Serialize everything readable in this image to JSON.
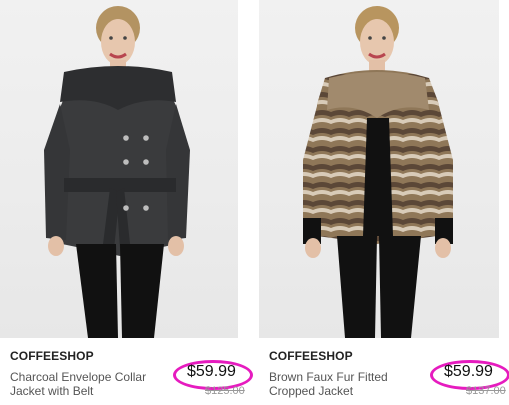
{
  "products": [
    {
      "brand": "COFFEESHOP",
      "name": "Charcoal Envelope Collar Jacket with Belt",
      "price": "$59.99",
      "original_price": "$125.00",
      "image_alt": "Woman wearing charcoal envelope collar jacket with belt"
    },
    {
      "brand": "COFFEESHOP",
      "name": "Brown Faux Fur Fitted Cropped Jacket",
      "price": "$59.99",
      "original_price": "$137.00",
      "image_alt": "Woman wearing brown faux fur fitted cropped jacket"
    }
  ],
  "colors": {
    "price_highlight": "#e61bbf",
    "brand_text": "#222222",
    "name_text": "#555555"
  }
}
